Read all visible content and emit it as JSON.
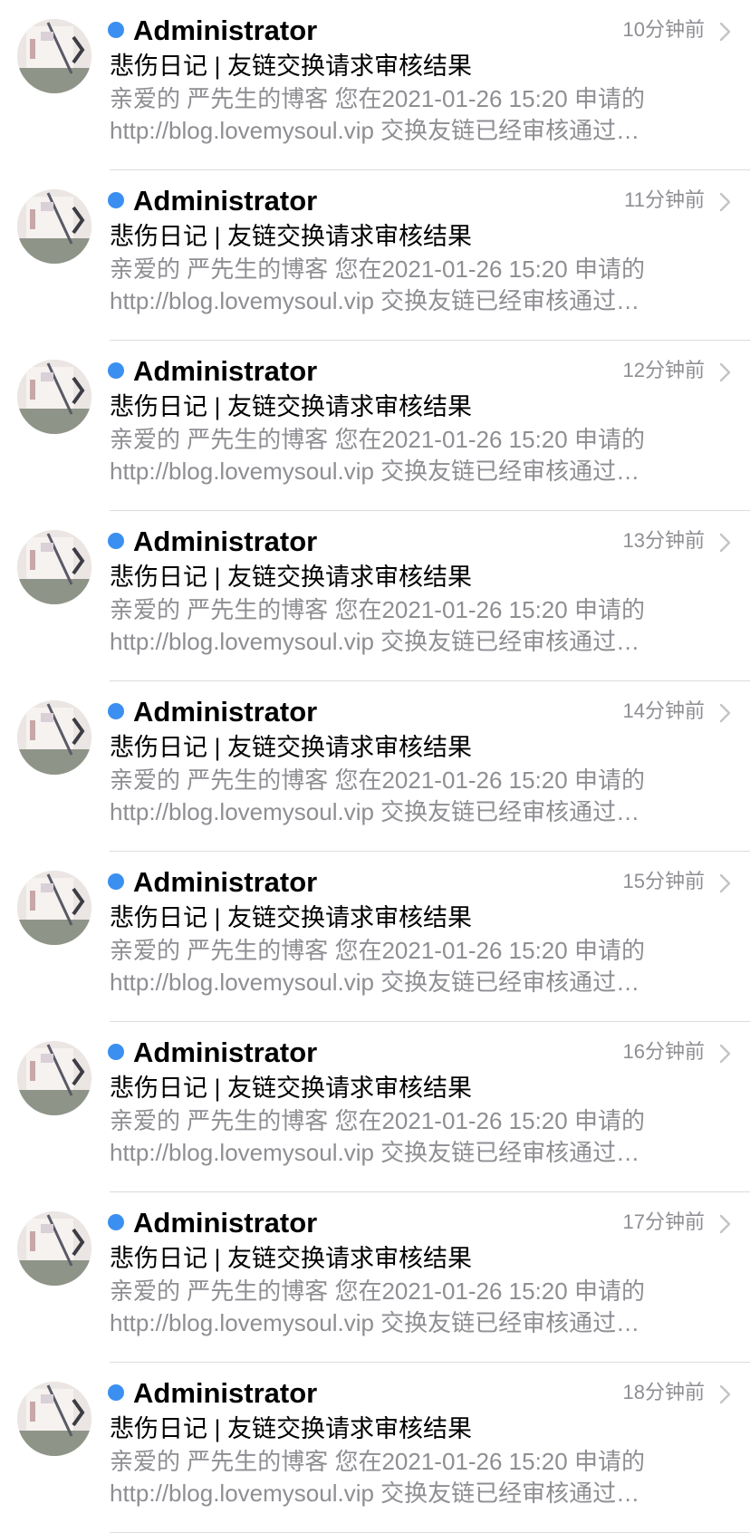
{
  "colors": {
    "unread_dot": "#3b8ff0",
    "sender": "#000000",
    "subject": "#000000",
    "preview": "#8e8e93",
    "time": "#8e8e93",
    "divider": "#dcdcdc",
    "chevron": "#c4c4c7"
  },
  "icons": {
    "avatar": "avatar-image",
    "unread": "unread-dot-icon",
    "disclosure": "chevron-right-icon"
  },
  "messages": [
    {
      "sender": "Administrator",
      "time": "10分钟前",
      "subject": "悲伤日记 | 友链交换请求审核结果",
      "preview_line1": "亲爱的 严先生的博客 您在2021-01-26 15:20 申请的",
      "preview_line2": "http://blog.lovemysoul.vip 交换友链已经审核通过…"
    },
    {
      "sender": "Administrator",
      "time": "11分钟前",
      "subject": "悲伤日记 | 友链交换请求审核结果",
      "preview_line1": "亲爱的 严先生的博客 您在2021-01-26 15:20 申请的",
      "preview_line2": "http://blog.lovemysoul.vip 交换友链已经审核通过…"
    },
    {
      "sender": "Administrator",
      "time": "12分钟前",
      "subject": "悲伤日记 | 友链交换请求审核结果",
      "preview_line1": "亲爱的 严先生的博客 您在2021-01-26 15:20 申请的",
      "preview_line2": "http://blog.lovemysoul.vip 交换友链已经审核通过…"
    },
    {
      "sender": "Administrator",
      "time": "13分钟前",
      "subject": "悲伤日记 | 友链交换请求审核结果",
      "preview_line1": "亲爱的 严先生的博客 您在2021-01-26 15:20 申请的",
      "preview_line2": "http://blog.lovemysoul.vip 交换友链已经审核通过…"
    },
    {
      "sender": "Administrator",
      "time": "14分钟前",
      "subject": "悲伤日记 | 友链交换请求审核结果",
      "preview_line1": "亲爱的 严先生的博客 您在2021-01-26 15:20 申请的",
      "preview_line2": "http://blog.lovemysoul.vip 交换友链已经审核通过…"
    },
    {
      "sender": "Administrator",
      "time": "15分钟前",
      "subject": "悲伤日记 | 友链交换请求审核结果",
      "preview_line1": "亲爱的 严先生的博客 您在2021-01-26 15:20 申请的",
      "preview_line2": "http://blog.lovemysoul.vip 交换友链已经审核通过…"
    },
    {
      "sender": "Administrator",
      "time": "16分钟前",
      "subject": "悲伤日记 | 友链交换请求审核结果",
      "preview_line1": "亲爱的 严先生的博客 您在2021-01-26 15:20 申请的",
      "preview_line2": "http://blog.lovemysoul.vip 交换友链已经审核通过…"
    },
    {
      "sender": "Administrator",
      "time": "17分钟前",
      "subject": "悲伤日记 | 友链交换请求审核结果",
      "preview_line1": "亲爱的 严先生的博客 您在2021-01-26 15:20 申请的",
      "preview_line2": "http://blog.lovemysoul.vip 交换友链已经审核通过…"
    },
    {
      "sender": "Administrator",
      "time": "18分钟前",
      "subject": "悲伤日记 | 友链交换请求审核结果",
      "preview_line1": "亲爱的 严先生的博客 您在2021-01-26 15:20 申请的",
      "preview_line2": "http://blog.lovemysoul.vip 交换友链已经审核通过…"
    }
  ]
}
